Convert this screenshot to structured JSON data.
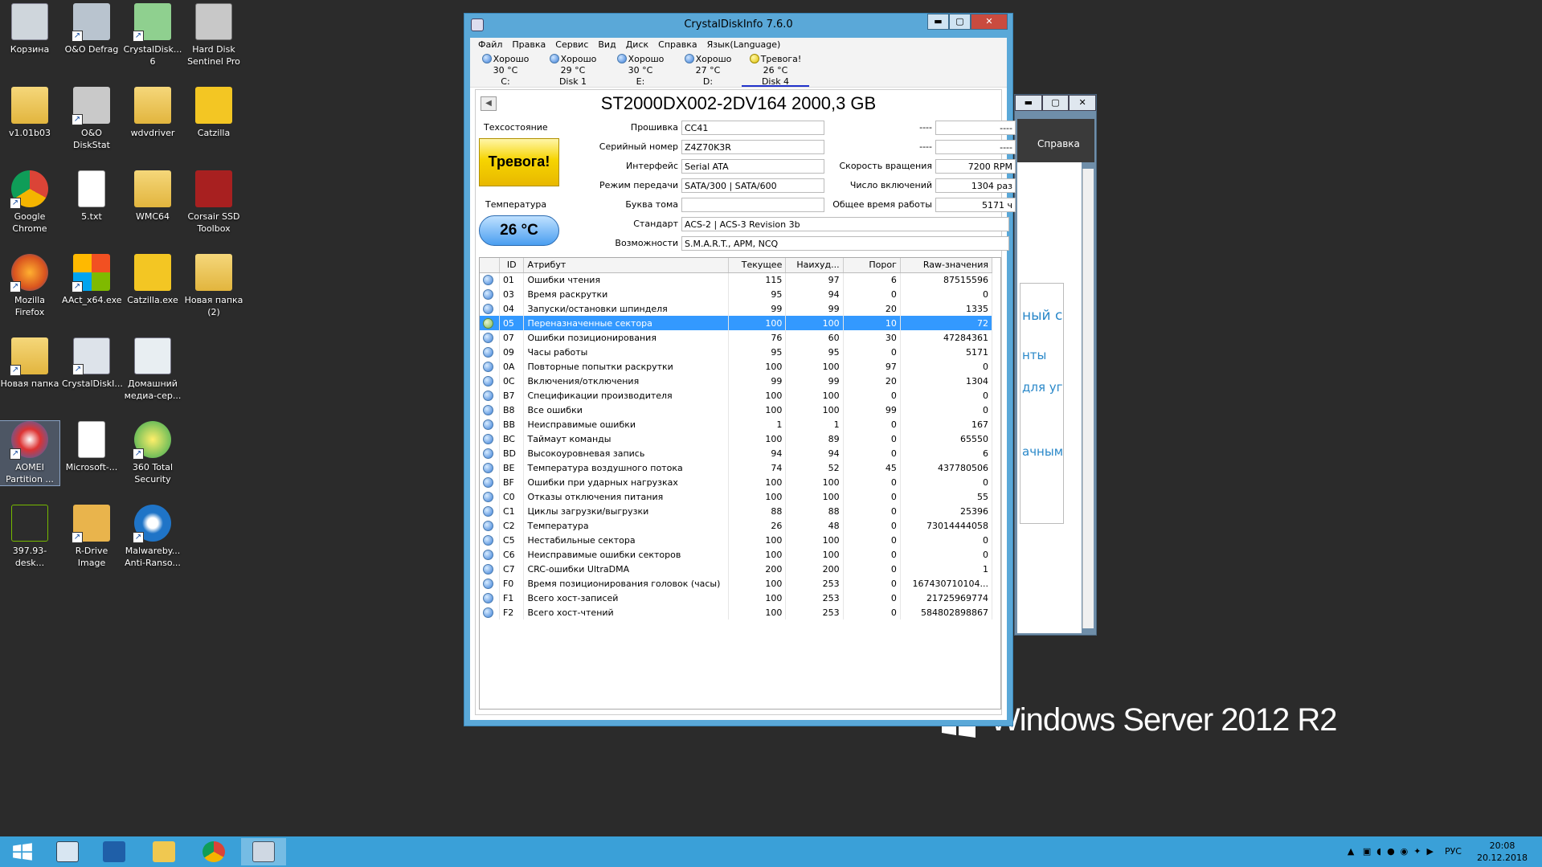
{
  "desktop": {
    "icons": [
      {
        "label": "Корзина"
      },
      {
        "label": "O&O Defrag"
      },
      {
        "label": "CrystalDisk... 6"
      },
      {
        "label": "Hard Disk Sentinel Pro"
      },
      {
        "label": "v1.01b03"
      },
      {
        "label": "O&O DiskStat"
      },
      {
        "label": "wdvdriver"
      },
      {
        "label": "Catzilla"
      },
      {
        "label": "Google Chrome"
      },
      {
        "label": "5.txt"
      },
      {
        "label": "WMC64"
      },
      {
        "label": "Corsair SSD Toolbox"
      },
      {
        "label": "Mozilla Firefox"
      },
      {
        "label": "AAct_x64.exe"
      },
      {
        "label": "Catzilla.exe"
      },
      {
        "label": "Новая папка (2)"
      },
      {
        "label": "Новая папка"
      },
      {
        "label": "CrystalDiskI..."
      },
      {
        "label": "Домашний медиа-сер..."
      },
      {
        "label": "AOMEI Partition ..."
      },
      {
        "label": "Microsoft-..."
      },
      {
        "label": "360 Total Security"
      },
      {
        "label": "397.93-desk..."
      },
      {
        "label": "R-Drive Image"
      },
      {
        "label": "Malwareby... Anti-Ranso..."
      }
    ],
    "watermark": "Windows Server 2012 R2"
  },
  "bgwindow": {
    "menu_label": "Справка",
    "frag1": "ный с",
    "frag2": "нты",
    "frag3": "для уг",
    "frag4": "ачным"
  },
  "window": {
    "title": "CrystalDiskInfo 7.6.0",
    "menu": [
      "Файл",
      "Правка",
      "Сервис",
      "Вид",
      "Диск",
      "Справка",
      "Язык(Language)"
    ],
    "disks": [
      {
        "status": "Хорошо",
        "temp": "30 °C",
        "name": "C:"
      },
      {
        "status": "Хорошо",
        "temp": "29 °C",
        "name": "Disk 1"
      },
      {
        "status": "Хорошо",
        "temp": "30 °C",
        "name": "E:"
      },
      {
        "status": "Хорошо",
        "temp": "27 °C",
        "name": "D:"
      },
      {
        "status": "Тревога!",
        "temp": "26 °C",
        "name": "Disk 4"
      }
    ],
    "model": "ST2000DX002-2DV164 2000,3 GB",
    "health_label": "Техсостояние",
    "health_value": "Тревога!",
    "temp_label": "Температура",
    "temp_value": "26 °C",
    "info": {
      "firmware_label": "Прошивка",
      "firmware": "CC41",
      "serial_label": "Серийный номер",
      "serial": "Z4Z70K3R",
      "interface_label": "Интерфейс",
      "interface": "Serial ATA",
      "transfer_label": "Режим передачи",
      "transfer": "SATA/300 | SATA/600",
      "letter_label": "Буква тома",
      "letter": "",
      "standard_label": "Стандарт",
      "standard": "ACS-2 | ACS-3 Revision 3b",
      "features_label": "Возможности",
      "features": "S.M.A.R.T., APM, NCQ",
      "dash1_label": "----",
      "dash1": "----",
      "dash2_label": "----",
      "dash2": "----",
      "rpm_label": "Скорость вращения",
      "rpm": "7200 RPM",
      "poweron_count_label": "Число включений",
      "poweron_count": "1304 раз",
      "poweron_hours_label": "Общее время работы",
      "poweron_hours": "5171 ч"
    },
    "table": {
      "headers": [
        "ID",
        "Атрибут",
        "Текущее",
        "Наихуд...",
        "Порог",
        "Raw-значения"
      ],
      "rows": [
        {
          "id": "01",
          "attr": "Ошибки чтения",
          "cur": "115",
          "worst": "97",
          "thr": "6",
          "raw": "87515596"
        },
        {
          "id": "03",
          "attr": "Время раскрутки",
          "cur": "95",
          "worst": "94",
          "thr": "0",
          "raw": "0"
        },
        {
          "id": "04",
          "attr": "Запуски/остановки шпинделя",
          "cur": "99",
          "worst": "99",
          "thr": "20",
          "raw": "1335"
        },
        {
          "id": "05",
          "attr": "Переназначенные сектора",
          "cur": "100",
          "worst": "100",
          "thr": "10",
          "raw": "72"
        },
        {
          "id": "07",
          "attr": "Ошибки позиционирования",
          "cur": "76",
          "worst": "60",
          "thr": "30",
          "raw": "47284361"
        },
        {
          "id": "09",
          "attr": "Часы работы",
          "cur": "95",
          "worst": "95",
          "thr": "0",
          "raw": "5171"
        },
        {
          "id": "0A",
          "attr": "Повторные попытки раскрутки",
          "cur": "100",
          "worst": "100",
          "thr": "97",
          "raw": "0"
        },
        {
          "id": "0C",
          "attr": "Включения/отключения",
          "cur": "99",
          "worst": "99",
          "thr": "20",
          "raw": "1304"
        },
        {
          "id": "B7",
          "attr": "Спецификации производителя",
          "cur": "100",
          "worst": "100",
          "thr": "0",
          "raw": "0"
        },
        {
          "id": "B8",
          "attr": "Все ошибки",
          "cur": "100",
          "worst": "100",
          "thr": "99",
          "raw": "0"
        },
        {
          "id": "BB",
          "attr": "Неисправимые ошибки",
          "cur": "1",
          "worst": "1",
          "thr": "0",
          "raw": "167"
        },
        {
          "id": "BC",
          "attr": "Таймаут команды",
          "cur": "100",
          "worst": "89",
          "thr": "0",
          "raw": "65550"
        },
        {
          "id": "BD",
          "attr": "Высокоуровневая запись",
          "cur": "94",
          "worst": "94",
          "thr": "0",
          "raw": "6"
        },
        {
          "id": "BE",
          "attr": "Температура воздушного потока",
          "cur": "74",
          "worst": "52",
          "thr": "45",
          "raw": "437780506"
        },
        {
          "id": "BF",
          "attr": "Ошибки при ударных нагрузках",
          "cur": "100",
          "worst": "100",
          "thr": "0",
          "raw": "0"
        },
        {
          "id": "C0",
          "attr": "Отказы отключения питания",
          "cur": "100",
          "worst": "100",
          "thr": "0",
          "raw": "55"
        },
        {
          "id": "C1",
          "attr": "Циклы загрузки/выгрузки",
          "cur": "88",
          "worst": "88",
          "thr": "0",
          "raw": "25396"
        },
        {
          "id": "C2",
          "attr": "Температура",
          "cur": "26",
          "worst": "48",
          "thr": "0",
          "raw": "73014444058"
        },
        {
          "id": "C5",
          "attr": "Нестабильные сектора",
          "cur": "100",
          "worst": "100",
          "thr": "0",
          "raw": "0"
        },
        {
          "id": "C6",
          "attr": "Неисправимые ошибки секторов",
          "cur": "100",
          "worst": "100",
          "thr": "0",
          "raw": "0"
        },
        {
          "id": "C7",
          "attr": "CRC-ошибки UltraDMA",
          "cur": "200",
          "worst": "200",
          "thr": "0",
          "raw": "1"
        },
        {
          "id": "F0",
          "attr": "Время позиционирования головок (часы)",
          "cur": "100",
          "worst": "253",
          "thr": "0",
          "raw": "167430710104..."
        },
        {
          "id": "F1",
          "attr": "Всего хост-записей",
          "cur": "100",
          "worst": "253",
          "thr": "0",
          "raw": "21725969774"
        },
        {
          "id": "F2",
          "attr": "Всего хост-чтений",
          "cur": "100",
          "worst": "253",
          "thr": "0",
          "raw": "584802898867"
        }
      ]
    }
  },
  "taskbar": {
    "lang": "РУС",
    "time": "20:08",
    "date": "20.12.2018"
  },
  "colors": {
    "accent": "#3aa0d8",
    "warning": "#f6d400",
    "selection": "#3399ff"
  }
}
